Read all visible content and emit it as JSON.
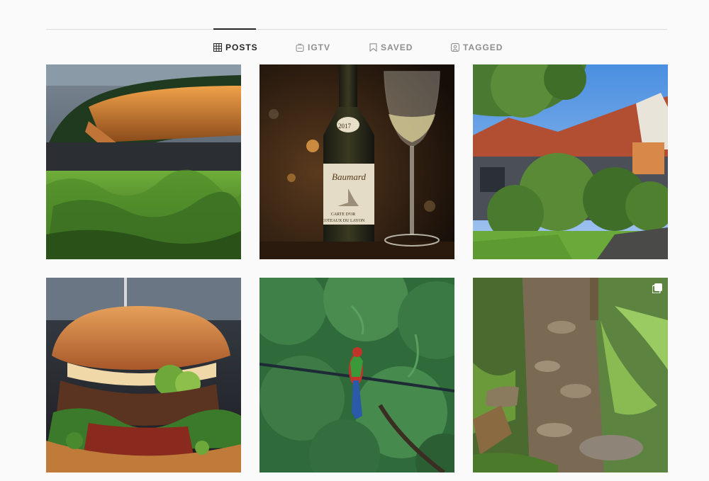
{
  "tabs": [
    {
      "label": "POSTS",
      "icon": "grid-icon",
      "active": true
    },
    {
      "label": "IGTV",
      "icon": "igtv-icon",
      "active": false
    },
    {
      "label": "SAVED",
      "icon": "bookmark-icon",
      "active": false
    },
    {
      "label": "TAGGED",
      "icon": "tagged-person-icon",
      "active": false
    }
  ],
  "posts": [
    {
      "subject": "building-living-wall"
    },
    {
      "subject": "wine-bottle-and-glass",
      "bottle_year": "2017",
      "bottle_brand": "Baumard",
      "bottle_line1": "CARTE D'OR",
      "bottle_line2": "COTEAUX DU LAYON"
    },
    {
      "subject": "brick-house-garden"
    },
    {
      "subject": "burger"
    },
    {
      "subject": "parrot-on-wire"
    },
    {
      "subject": "garden-stone-path",
      "multiple_icon": "multiple-photos-icon"
    }
  ],
  "colors": {
    "active_tab": "#262626",
    "inactive_tab": "#8e8e8e",
    "divider": "#dbdbdb",
    "background": "#fafafa"
  }
}
